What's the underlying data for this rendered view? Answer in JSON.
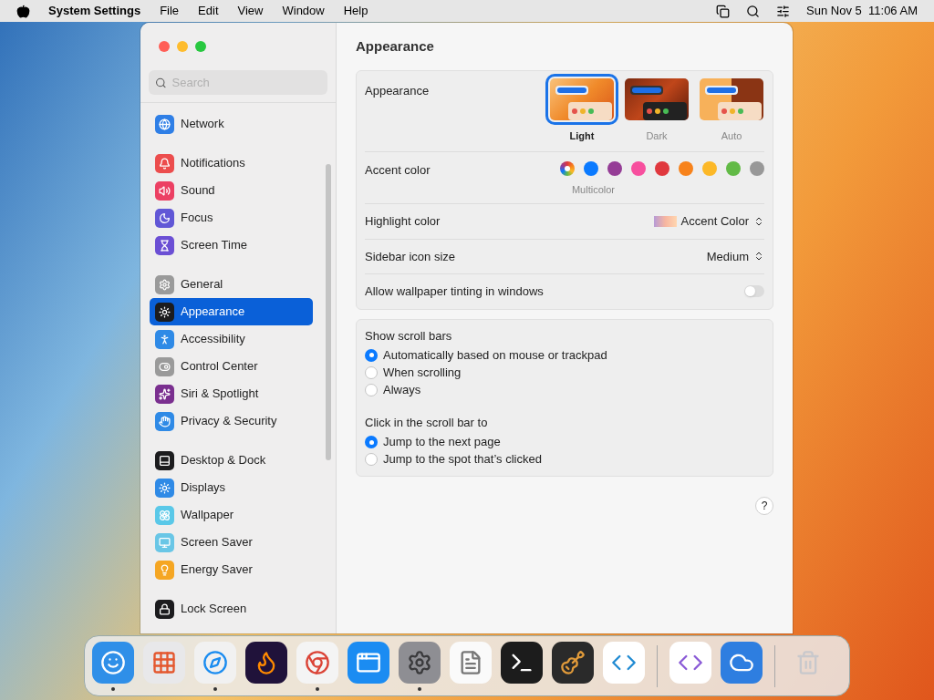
{
  "menu_bar": {
    "app_name": "System Settings",
    "menus": [
      "File",
      "Edit",
      "View",
      "Window",
      "Help"
    ],
    "clock": "Sun Nov 5  11:06 AM"
  },
  "sidebar": {
    "search": {
      "placeholder": "Search"
    },
    "groups": [
      [
        {
          "label": "Network",
          "kind": "network",
          "selected": false
        }
      ],
      [
        {
          "label": "Notifications",
          "kind": "notifications",
          "selected": false
        },
        {
          "label": "Sound",
          "kind": "sound",
          "selected": false
        },
        {
          "label": "Focus",
          "kind": "focus",
          "selected": false
        },
        {
          "label": "Screen Time",
          "kind": "screentime",
          "selected": false
        }
      ],
      [
        {
          "label": "General",
          "kind": "general",
          "selected": false
        },
        {
          "label": "Appearance",
          "kind": "appearance",
          "selected": true
        },
        {
          "label": "Accessibility",
          "kind": "accessibility",
          "selected": false
        },
        {
          "label": "Control Center",
          "kind": "controlcenter",
          "selected": false
        },
        {
          "label": "Siri & Spotlight",
          "kind": "siri",
          "selected": false
        },
        {
          "label": "Privacy & Security",
          "kind": "privacy",
          "selected": false
        }
      ],
      [
        {
          "label": "Desktop & Dock",
          "kind": "desktop",
          "selected": false
        },
        {
          "label": "Displays",
          "kind": "displays",
          "selected": false
        },
        {
          "label": "Wallpaper",
          "kind": "wallpaper",
          "selected": false
        },
        {
          "label": "Screen Saver",
          "kind": "screensaver",
          "selected": false
        },
        {
          "label": "Energy Saver",
          "kind": "energy",
          "selected": false
        }
      ],
      [
        {
          "label": "Lock Screen",
          "kind": "lock",
          "selected": false
        }
      ]
    ]
  },
  "content": {
    "title": "Appearance",
    "appearance": {
      "label": "Appearance",
      "options": [
        {
          "label": "Light",
          "kind": "light",
          "selected": true
        },
        {
          "label": "Dark",
          "kind": "dark",
          "selected": false
        },
        {
          "label": "Auto",
          "kind": "auto",
          "selected": false
        }
      ]
    },
    "accent": {
      "label": "Accent color",
      "caption": "Multicolor",
      "colors": [
        {
          "kind": "multicolor",
          "selected": true
        },
        {
          "kind": "solid",
          "color": "#0a7aff",
          "selected": false
        },
        {
          "kind": "solid",
          "color": "#953d96",
          "selected": false
        },
        {
          "kind": "solid",
          "color": "#f74f9e",
          "selected": false
        },
        {
          "kind": "solid",
          "color": "#e0383e",
          "selected": false
        },
        {
          "kind": "solid",
          "color": "#f7821b",
          "selected": false
        },
        {
          "kind": "solid",
          "color": "#fcb827",
          "selected": false
        },
        {
          "kind": "solid",
          "color": "#62ba46",
          "selected": false
        },
        {
          "kind": "solid",
          "color": "#989898",
          "selected": false
        }
      ]
    },
    "highlight": {
      "label": "Highlight color",
      "value": "Accent Color"
    },
    "sidebar_icon_size": {
      "label": "Sidebar icon size",
      "value": "Medium"
    },
    "tinting": {
      "label": "Allow wallpaper tinting in windows",
      "on": false
    },
    "radio_groups": [
      {
        "label": "Show scroll bars",
        "options": [
          {
            "label": "Automatically based on mouse or trackpad",
            "selected": true
          },
          {
            "label": "When scrolling",
            "selected": false
          },
          {
            "label": "Always",
            "selected": false
          }
        ]
      },
      {
        "label": "Click in the scroll bar to",
        "options": [
          {
            "label": "Jump to the next page",
            "selected": true
          },
          {
            "label": "Jump to the spot that’s clicked",
            "selected": false
          }
        ]
      }
    ],
    "help": "?"
  },
  "dock": {
    "items": [
      {
        "kind": "finder",
        "running": true
      },
      {
        "kind": "launchpad",
        "running": false
      },
      {
        "kind": "safari",
        "running": true
      },
      {
        "kind": "firefox",
        "running": false
      },
      {
        "kind": "chrome",
        "running": true
      },
      {
        "kind": "appstore",
        "running": false
      },
      {
        "kind": "settings",
        "running": true
      },
      {
        "kind": "textedit",
        "running": false
      },
      {
        "kind": "terminal",
        "running": false
      },
      {
        "kind": "garageband",
        "running": false
      },
      {
        "kind": "vscode",
        "running": false
      },
      {
        "kind": "separator"
      },
      {
        "kind": "visualstudio",
        "running": false
      },
      {
        "kind": "weather",
        "running": false
      },
      {
        "kind": "separator"
      },
      {
        "kind": "trash",
        "running": false
      }
    ]
  }
}
